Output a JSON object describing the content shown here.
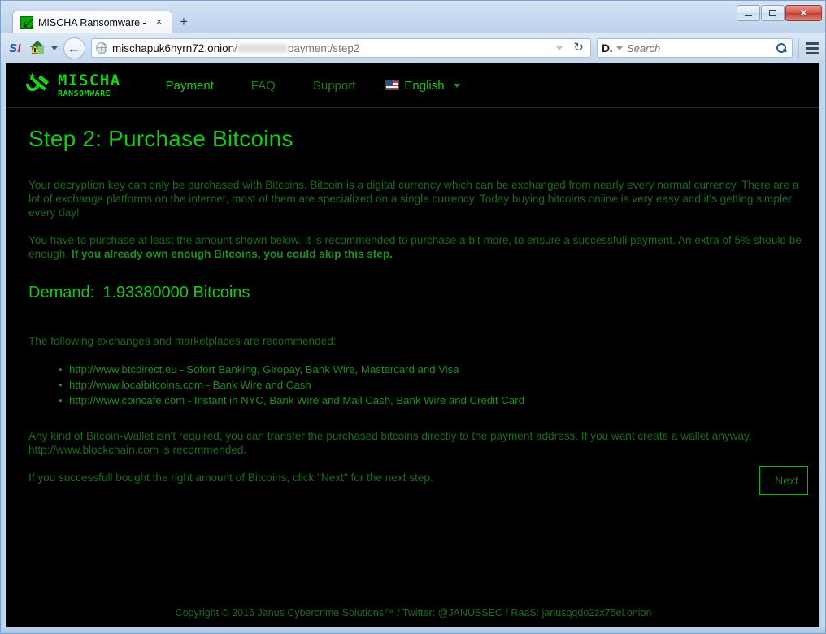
{
  "browser": {
    "tab": {
      "title": "MISCHA Ransomware - Pa...",
      "favicon": "hammer-sickle-icon",
      "close_label": "×"
    },
    "newtab_label": "+",
    "window_controls": {
      "minimize": "minimize-icon",
      "maximize": "maximize-icon",
      "close": "✕"
    },
    "toolbar": {
      "sophos_icon_s": "S",
      "sophos_icon_bang": "!",
      "back_arrow": "←",
      "reload_icon": "↻"
    },
    "url": {
      "host": "mischapuk6hyrn72.onion",
      "separator": "/",
      "redacted": "",
      "path": "/payment/step2",
      "path_visible": "payment/step2"
    },
    "search": {
      "engine_icon": "D.",
      "placeholder": "Search",
      "value": ""
    }
  },
  "site": {
    "logo": {
      "emblem": "hammer-and-sickle-with-star",
      "main": "MISCHA",
      "sub": "RANSOMWARE"
    },
    "nav": [
      {
        "label": "Payment",
        "active": true
      },
      {
        "label": "FAQ",
        "active": false
      },
      {
        "label": "Support",
        "active": false
      }
    ],
    "language": {
      "flag": "us-flag-icon",
      "label": "English",
      "caret": "▾"
    }
  },
  "page": {
    "title": "Step 2: Purchase Bitcoins",
    "paragraph_1": "Your decryption key can only be purchased with Bitcoins. Bitcoin is a digital currency which can be exchanged from nearly every normal currency. There are a lot of exchange platforms on the internet, most of them are specialized on a single currency. Today buying bitcoins online is very easy and it's getting simpler every day!",
    "paragraph_2_part1": "You have to purchase at least the amount shown below. It is recommended to purchase a bit more, to ensure a successfull payment. An extra of 5% should be enough. ",
    "paragraph_2_bold": "If you already own enough Bitcoins, you could skip this step.",
    "demand_label": "Demand:",
    "demand_value": "1.93380000 Bitcoins",
    "demand_amount": "1.93380000",
    "demand_currency": "Bitcoins",
    "recommend_intro": "The following exchanges and marketplaces are recommended:",
    "exchanges": [
      {
        "url": "http://www.btcdirect.eu",
        "description": " - Sofort Banking, Giropay, Bank Wire, Mastercard and Visa"
      },
      {
        "url": "http://www.localbitcoins.com",
        "description": " - Bank Wire and Cash"
      },
      {
        "url": "http://www.coincafe.com",
        "description": " - Instant in NYC, Bank Wire and Mail Cash, Bank Wire and Credit Card"
      }
    ],
    "wallet_note": "Any kind of Bitcoin-Wallet isn't required, you can transfer the purchased bitcoins directly to the payment address. If you want create a wallet anyway, http://www.blockchain.com is recommended.",
    "next_note": "If you successfull bought the right amount of Bitcoins, click \"Next\" for the next step.",
    "next_button": "Next",
    "footer": "Copyright © 2016 Janus Cybercrime Solutions™ / Twitter: @JANUSSEC / RaaS: janusqqdo2zx75el.onion"
  },
  "colors": {
    "accent_bright_green": "#14c914",
    "body_green": "#1a6b1a",
    "link_green": "#1e8c1e",
    "background": "#000000"
  }
}
